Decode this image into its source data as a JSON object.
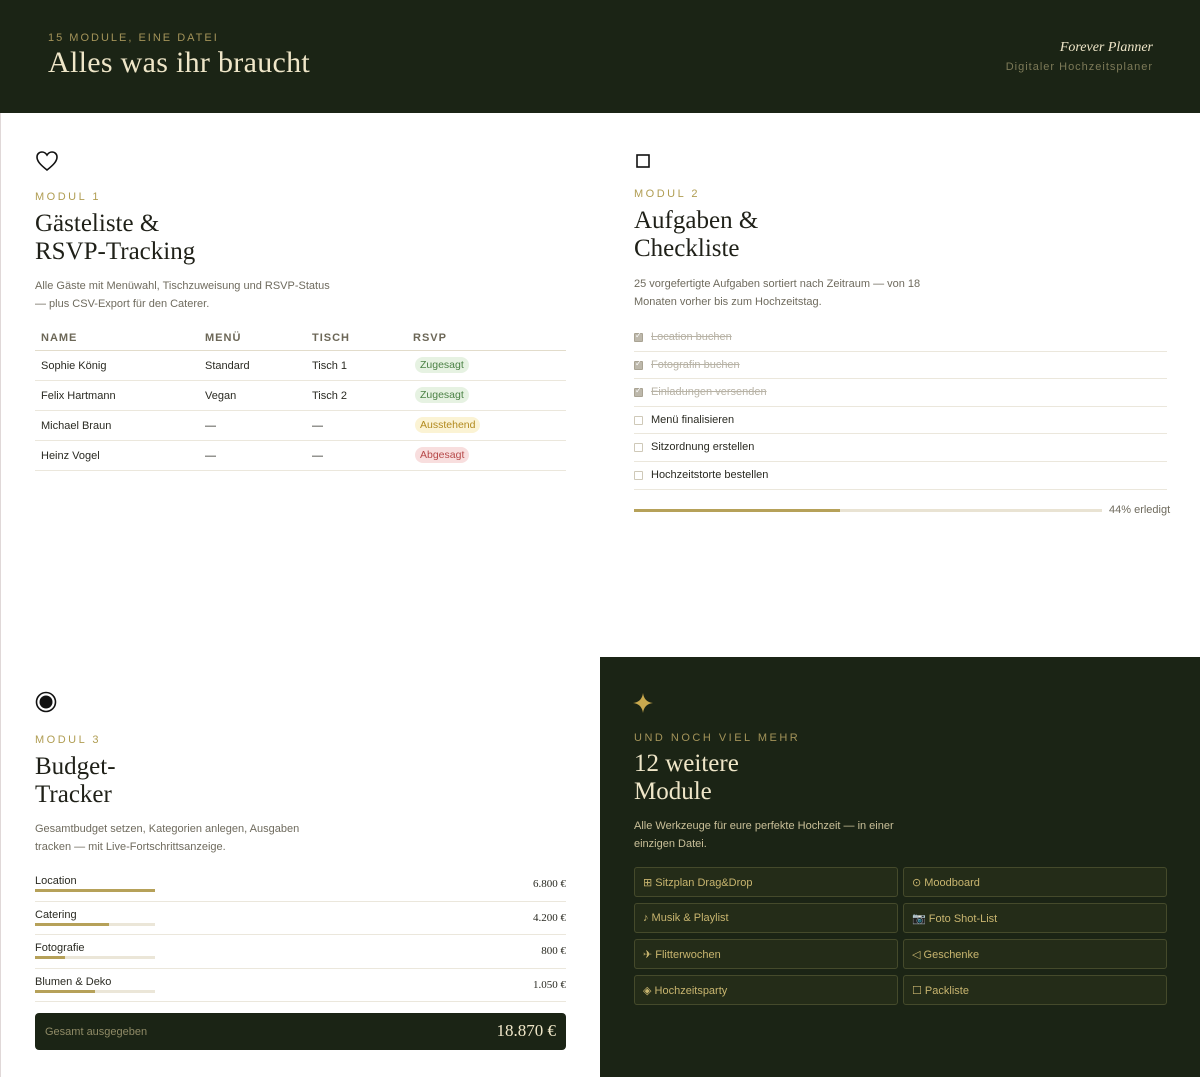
{
  "header": {
    "eyebrow": "15 MODULE, EINE DATEI",
    "title": "Alles was ihr braucht",
    "brand": "Forever Planner",
    "brand_sub": "Digitaler Hochzeitsplaner"
  },
  "module1": {
    "icon": "heart-icon",
    "label": "MODUL 1",
    "title_line1": "Gästeliste &",
    "title_line2": "RSVP-Tracking",
    "desc_line1": "Alle Gäste mit Menüwahl, Tischzuweisung und RSVP-Status",
    "desc_line2": "— plus CSV-Export für den Caterer.",
    "columns": [
      "NAME",
      "MENÜ",
      "TISCH",
      "RSVP"
    ],
    "rows": [
      {
        "name": "Sophie König",
        "menu": "Standard",
        "table": "Tisch 1",
        "rsvp": "Zugesagt",
        "status": "yes"
      },
      {
        "name": "Felix Hartmann",
        "menu": "Vegan",
        "table": "Tisch 2",
        "rsvp": "Zugesagt",
        "status": "yes"
      },
      {
        "name": "Michael Braun",
        "menu": "—",
        "table": "—",
        "rsvp": "Ausstehend",
        "status": "pending"
      },
      {
        "name": "Heinz Vogel",
        "menu": "—",
        "table": "—",
        "rsvp": "Abgesagt",
        "status": "no"
      }
    ]
  },
  "module2": {
    "icon": "square-icon",
    "label": "MODUL 2",
    "title_line1": "Aufgaben &",
    "title_line2": "Checkliste",
    "desc_line1": "25 vorgefertigte Aufgaben sortiert nach Zeitraum — von 18",
    "desc_line2": "Monaten vorher bis zum Hochzeitstag.",
    "items": [
      {
        "label": "Location buchen",
        "done": true
      },
      {
        "label": "Fotografin buchen",
        "done": true
      },
      {
        "label": "Einladungen versenden",
        "done": true
      },
      {
        "label": "Menü finalisieren",
        "done": false
      },
      {
        "label": "Sitzordnung erstellen",
        "done": false
      },
      {
        "label": "Hochzeitstorte bestellen",
        "done": false
      }
    ],
    "progress": 0.44,
    "progress_label": "44% erledigt"
  },
  "module3": {
    "icon": "target-icon",
    "label": "MODUL 3",
    "title_line1": "Budget-",
    "title_line2": "Tracker",
    "desc_line1": "Gesamtbudget setzen, Kategorien anlegen, Ausgaben",
    "desc_line2": "tracken — mit Live-Fortschrittsanzeige.",
    "items": [
      {
        "label": "Location",
        "value": "6.800 €",
        "fraction": 1.0
      },
      {
        "label": "Catering",
        "value": "4.200 €",
        "fraction": 0.62
      },
      {
        "label": "Fotografie",
        "value": "800 €",
        "fraction": 0.25
      },
      {
        "label": "Blumen & Deko",
        "value": "1.050 €",
        "fraction": 0.5
      }
    ],
    "total_label": "Gesamt ausgegeben",
    "total_value": "18.870 €"
  },
  "more": {
    "icon": "sparkle-icon",
    "eyebrow": "UND NOCH VIEL MEHR",
    "title_line1": "12 weitere",
    "title_line2": "Module",
    "desc_line1": "Alle Werkzeuge für eure perfekte Hochzeit — in einer",
    "desc_line2": "einzigen Datei.",
    "chips": [
      "⊞ Sitzplan Drag&Drop",
      "⊙ Moodboard",
      "♪ Musik & Playlist",
      "📷 Foto Shot-List",
      "✈ Flitterwochen",
      "◁ Geschenke",
      "◈ Hochzeitsparty",
      "☐ Packliste"
    ]
  },
  "colors": {
    "dark_green": "#1b2415",
    "gold": "#b6a159",
    "cream": "#efe6c8"
  }
}
